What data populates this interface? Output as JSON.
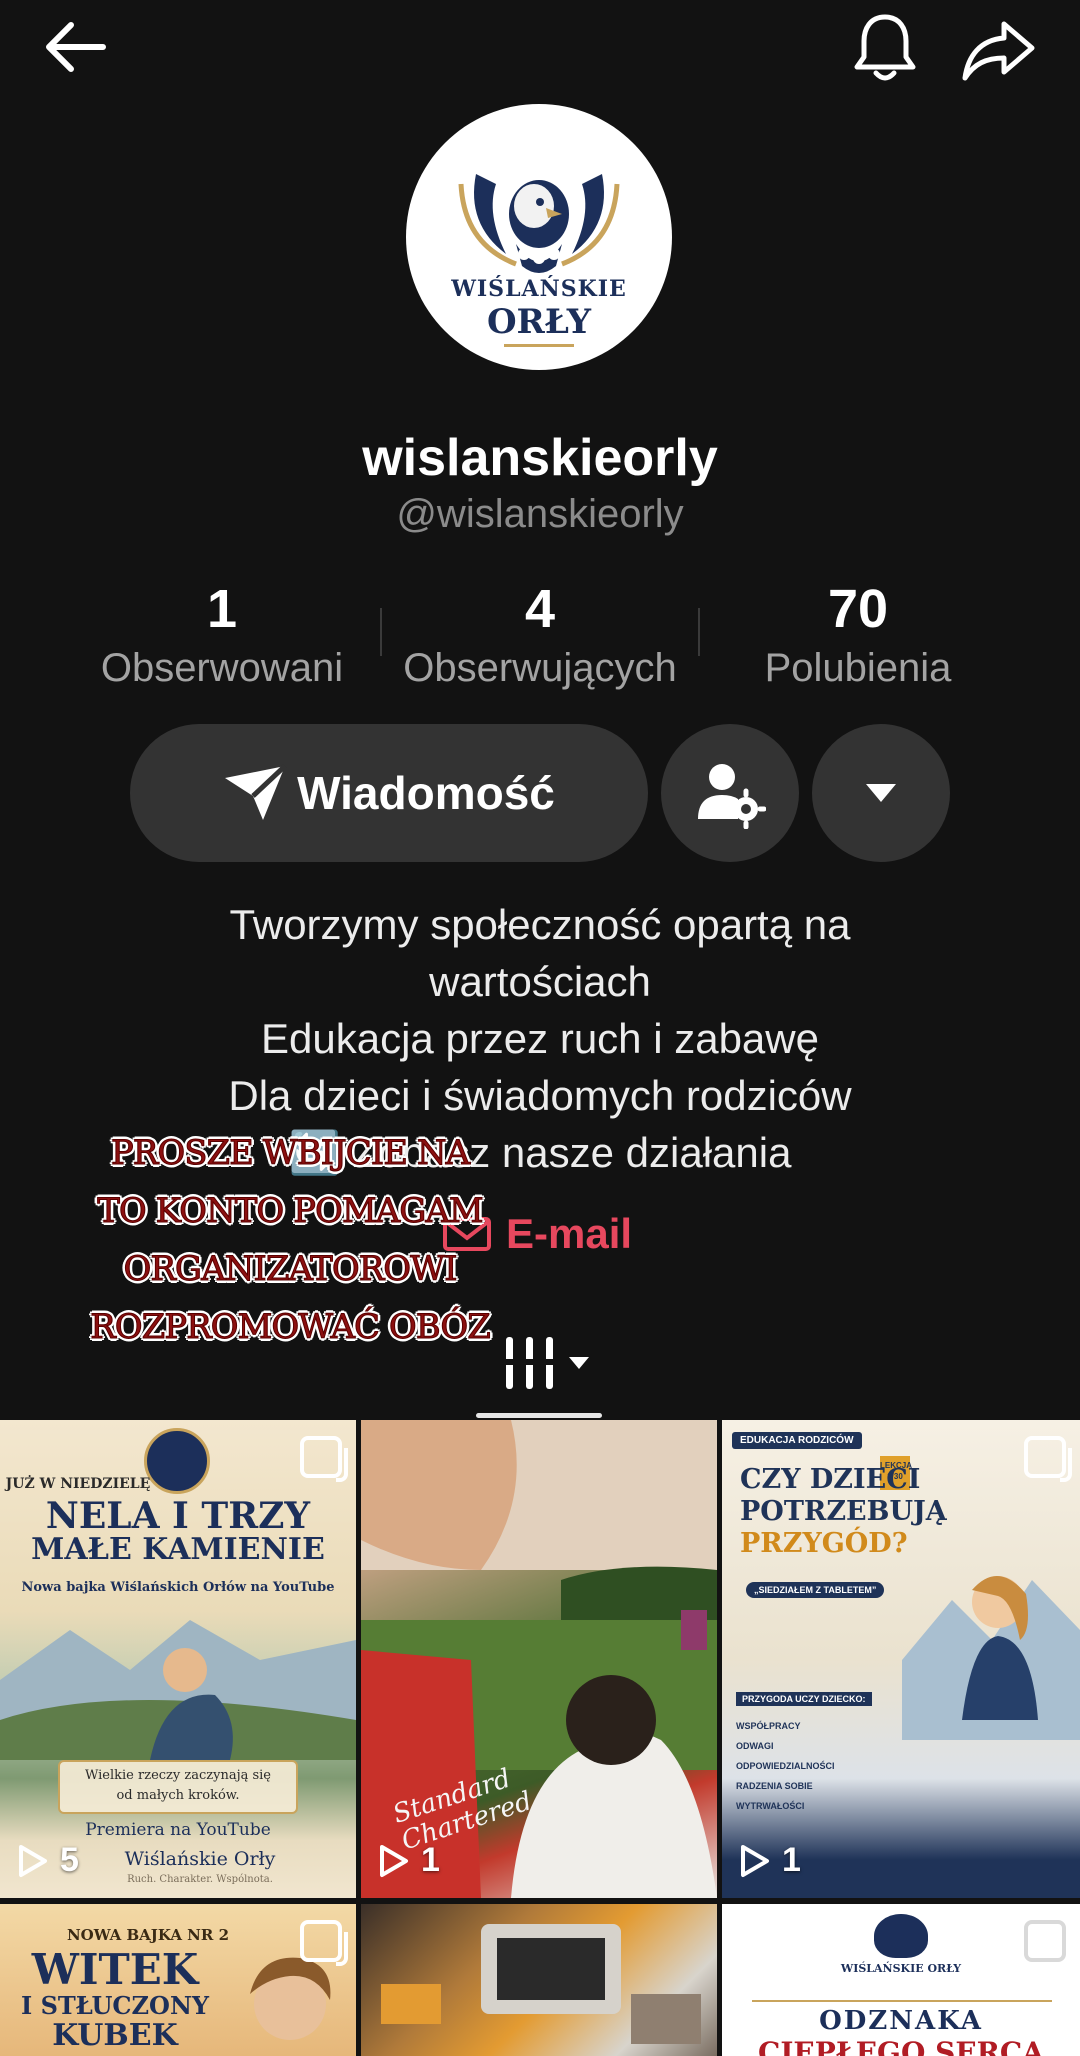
{
  "header": {
    "back_icon": "arrow-left-icon",
    "bell_icon": "bell-icon",
    "share_icon": "share-arrow-icon"
  },
  "profile": {
    "avatar_lines": [
      "WIŚLAŃSKIE",
      "ORŁY"
    ],
    "display_name": "wislanskieorly",
    "handle": "@wislanskieorly"
  },
  "stats": [
    {
      "value": "1",
      "label": "Obserwowani"
    },
    {
      "value": "4",
      "label": "Obserwujących"
    },
    {
      "value": "70",
      "label": "Polubienia"
    }
  ],
  "actions": {
    "message_label": "Wiadomość",
    "message_icon": "send-icon",
    "user_settings_icon": "user-settings-icon",
    "more_icon": "caret-down-icon"
  },
  "bio": {
    "lines": [
      "Tworzymy społeczność opartą na",
      "wartościach",
      "Edukacja przez ruch i zabawę",
      "Dla dzieci i świadomych rodziców",
      "🔄 Zobacz nasze działania"
    ],
    "email_label": "E-mail"
  },
  "overlay_text": {
    "lines": [
      "PROSZE WBIJCIE NA",
      "TO KONTO POMAGAM",
      "ORGANIZATOROWI",
      "ROZPROMOWAĆ OBÓZ"
    ]
  },
  "tabs": {
    "active_icon": "grid-icon"
  },
  "videos": [
    {
      "views": "5",
      "header": "JUŻ W NIEDZIELĘ",
      "title_lines": [
        "NELA I TRZY",
        "MAŁE KAMIENIE"
      ],
      "subtitle": "Nowa bajka Wiślańskich Orłów na YouTube",
      "caption_lines": [
        "Wielkie rzeczy zaczynają się",
        "od małych kroków."
      ],
      "footer": "Premiera na YouTube",
      "brand": "Wiślańskie Orły",
      "motto": "Ruch. Charakter. Wspólnota."
    },
    {
      "views": "1",
      "shirt_text": [
        "Standard",
        "Chartered"
      ]
    },
    {
      "views": "1",
      "tag": "EDUKACJA RODZICÓW",
      "lesson": "LEKCJA 2/30",
      "title_lines": [
        "CZY DZIECI",
        "POTRZEBUJĄ",
        "PRZYGÓD?"
      ],
      "quote_tag": "„SIEDZIAŁEM Z TABLETEM”",
      "section": "PRZYGODA UCZY DZIECKO:",
      "skills": [
        "WSPÓŁPRACY",
        "ODWAGI",
        "ODPOWIEDZIALNOŚCI",
        "RADZENIA SOBIE",
        "WYTRWAŁOŚCI"
      ]
    },
    {
      "header": "NOWA BAJKA NR 2",
      "title_lines": [
        "WITEK",
        "I STŁUCZONY",
        "KUBEK"
      ]
    },
    {},
    {
      "brand": "WIŚLAŃSKIE ORŁY",
      "title_lines": [
        "ODZNAKA",
        "CIEPŁEGO SERCA"
      ]
    }
  ],
  "colors": {
    "background": "#121212",
    "button": "#333333",
    "accent_link": "#e7485e",
    "muted_text": "#8b8b8b",
    "brand_navy": "#1c2f5a"
  }
}
